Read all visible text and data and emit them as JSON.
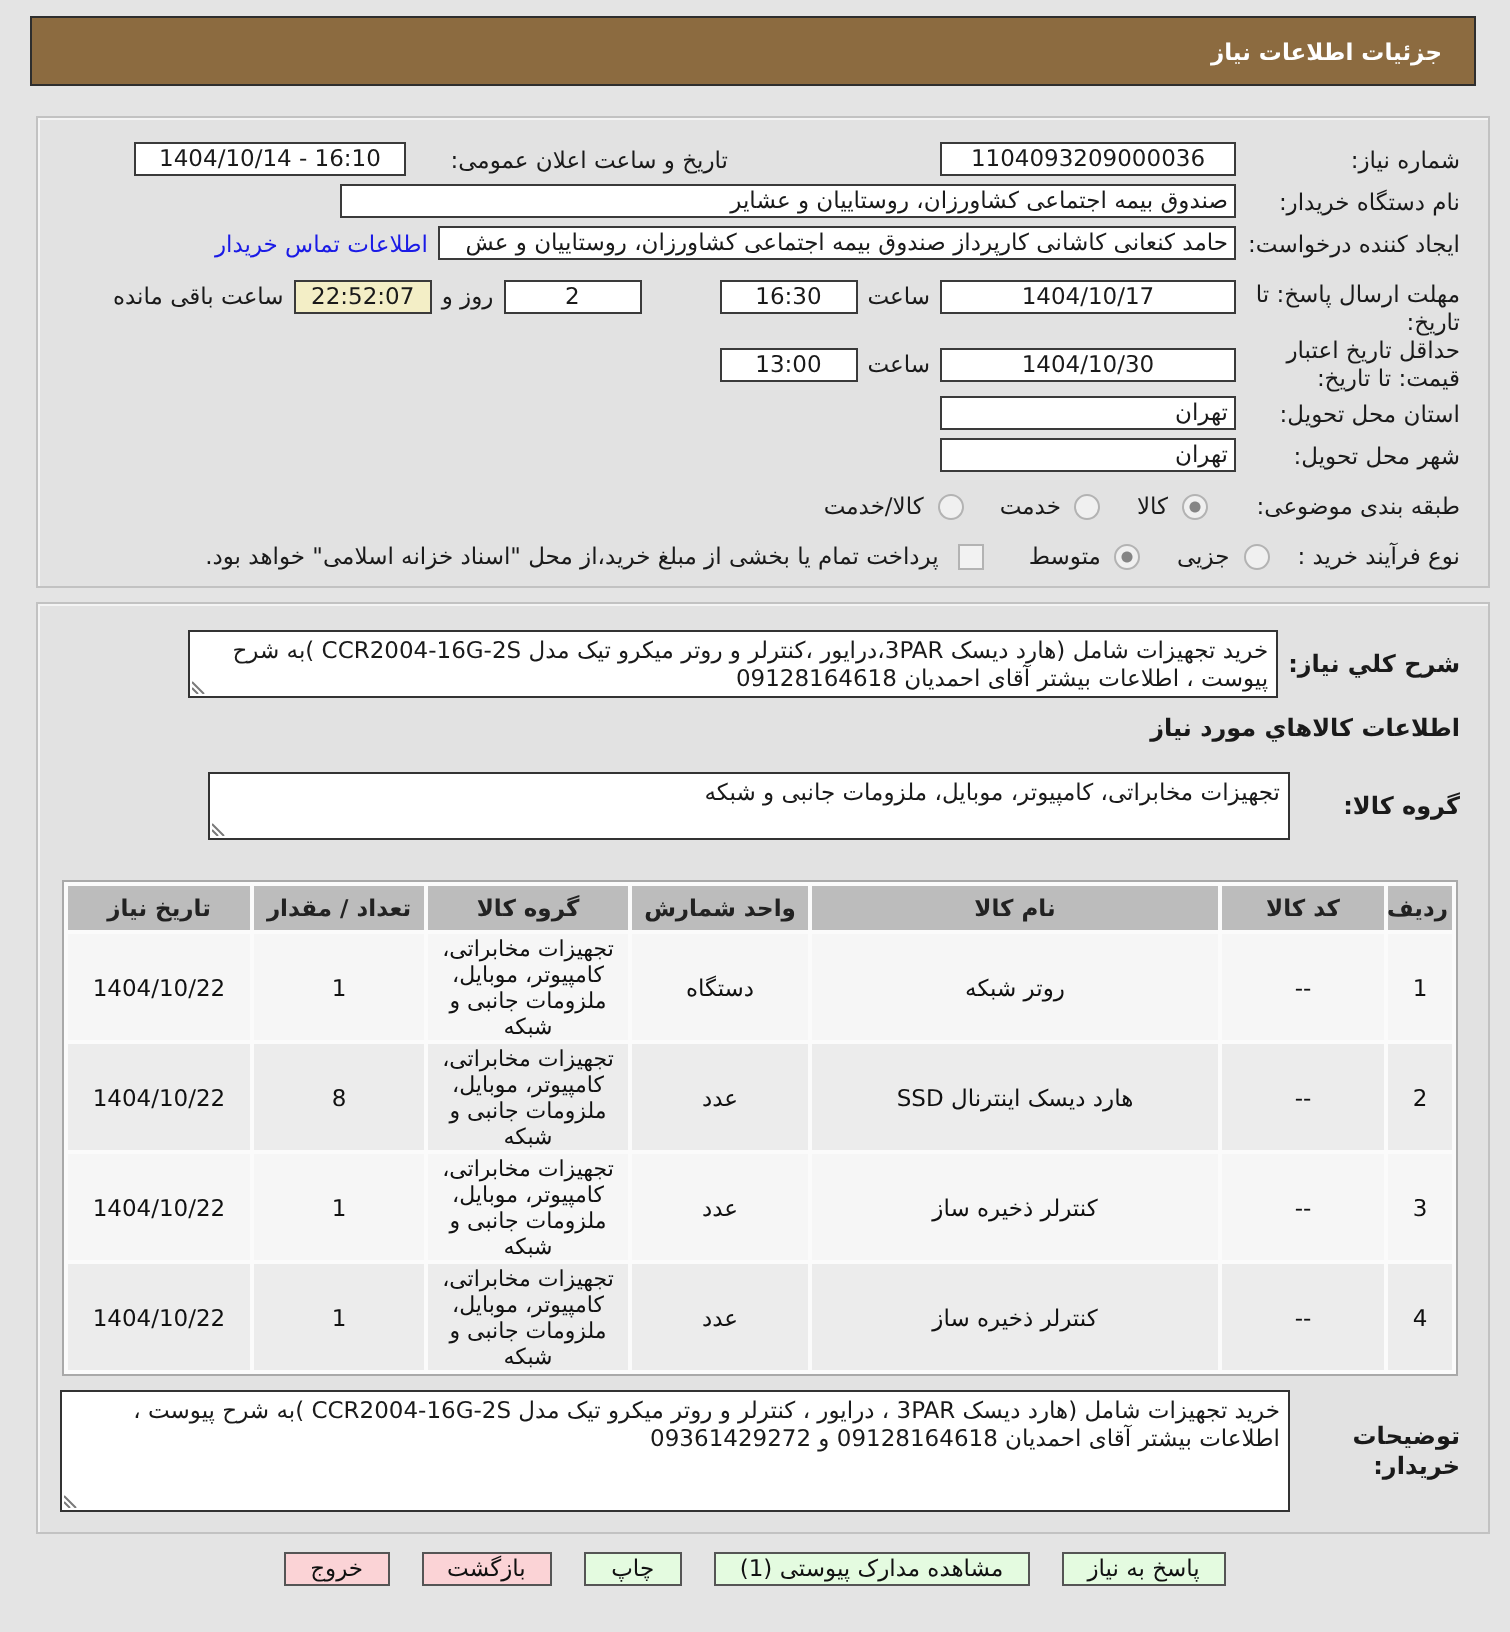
{
  "header": {
    "title": "جزئیات اطلاعات نیاز"
  },
  "details": {
    "need_number": {
      "label": "شماره نیاز:",
      "value": "1104093209000036"
    },
    "announcement": {
      "label": "تاریخ و ساعت اعلان عمومی:",
      "value": "1404/10/14 - 16:10"
    },
    "buyer_organization": {
      "label": "نام دستگاه خریدار:",
      "value": "صندوق بیمه اجتماعی کشاورزان، روستاییان و عشایر"
    },
    "requester": {
      "label": "ایجاد کننده درخواست:",
      "value": "حامد کنعانی کاشانی کارپرداز صندوق بیمه اجتماعی کشاورزان، روستاییان و عش",
      "contact_link": "اطلاعات تماس خریدار"
    },
    "response_deadline": {
      "label": "مهلت ارسال پاسخ: تا تاریخ:",
      "date": "1404/10/17",
      "time_label": "ساعت",
      "time": "16:30",
      "days": "2",
      "days_label": "روز و",
      "remaining": "22:52:07",
      "remaining_label": "ساعت باقی مانده"
    },
    "price_validity": {
      "label": "حداقل تاریخ اعتبار قیمت: تا تاریخ:",
      "date": "1404/10/30",
      "time_label": "ساعت",
      "time": "13:00"
    },
    "delivery_province": {
      "label": "استان محل تحویل:",
      "value": "تهران"
    },
    "delivery_city": {
      "label": "شهر محل تحویل:",
      "value": "تهران"
    },
    "subject_category": {
      "label": "طبقه بندی موضوعی:",
      "options": [
        {
          "label": "کالا",
          "selected": true
        },
        {
          "label": "خدمت",
          "selected": false
        },
        {
          "label": "کالا/خدمت",
          "selected": false
        }
      ]
    },
    "purchase_process": {
      "label": "نوع فرآیند خرید :",
      "options": [
        {
          "label": "جزیی",
          "selected": false
        },
        {
          "label": "متوسط",
          "selected": true
        }
      ],
      "treasury_payment": {
        "label": "پرداخت تمام یا بخشی از مبلغ خرید،از محل \"اسناد خزانه اسلامی\" خواهد بود.",
        "checked": false
      }
    }
  },
  "need_summary": {
    "label": "شرح کلي نياز:",
    "text": "خرید تجهیزات شامل (هارد دیسک 3PAR،درایور ،کنترلر و روتر میکرو تیک مدل CCR2004-16G-2S )به شرح پیوست ، اطلاعات بیشتر آقای احمدیان 09128164618"
  },
  "goods": {
    "heading": "اطلاعات کالاهاي مورد نياز",
    "group_label": "گروه کالا:",
    "group": "تجهیزات مخابراتی، کامپیوتر، موبایل، ملزومات جانبی و شبکه",
    "table": {
      "columns": [
        "ردیف",
        "کد کالا",
        "نام کالا",
        "واحد شمارش",
        "گروه کالا",
        "تعداد / مقدار",
        "تاریخ نیاز"
      ],
      "rows": [
        [
          "1",
          "--",
          "روتر شبکه",
          "دستگاه",
          "تجهیزات مخابراتی، کامپیوتر، موبایل، ملزومات جانبی و شبکه",
          "1",
          "1404/10/22"
        ],
        [
          "2",
          "--",
          "هارد دیسک اینترنال SSD",
          "عدد",
          "تجهیزات مخابراتی، کامپیوتر، موبایل، ملزومات جانبی و شبکه",
          "8",
          "1404/10/22"
        ],
        [
          "3",
          "--",
          "کنترلر ذخیره ساز",
          "عدد",
          "تجهیزات مخابراتی، کامپیوتر، موبایل، ملزومات جانبی و شبکه",
          "1",
          "1404/10/22"
        ],
        [
          "4",
          "--",
          "کنترلر ذخیره ساز",
          "عدد",
          "تجهیزات مخابراتی، کامپیوتر، موبایل، ملزومات جانبی و شبکه",
          "1",
          "1404/10/22"
        ]
      ]
    }
  },
  "buyer_notes": {
    "label": "توضیحات خریدار:",
    "text": "خرید تجهیزات شامل (هارد دیسک 3PAR ، درایور ، کنترلر و روتر میکرو تیک مدل CCR2004-16G-2S )به شرح پیوست ، اطلاعات بیشتر آقای احمدیان 09128164618 و 09361429272"
  },
  "buttons": [
    {
      "label": "پاسخ به نیاز",
      "color": "#e4fbe0"
    },
    {
      "label": "مشاهده مدارک پیوستی (1)",
      "color": "#e4fbe0"
    },
    {
      "label": "چاپ",
      "color": "#e4fbe0"
    },
    {
      "label": "بازگشت",
      "color": "#fbd3d6"
    },
    {
      "label": "خروج",
      "color": "#fbd3d6"
    }
  ]
}
